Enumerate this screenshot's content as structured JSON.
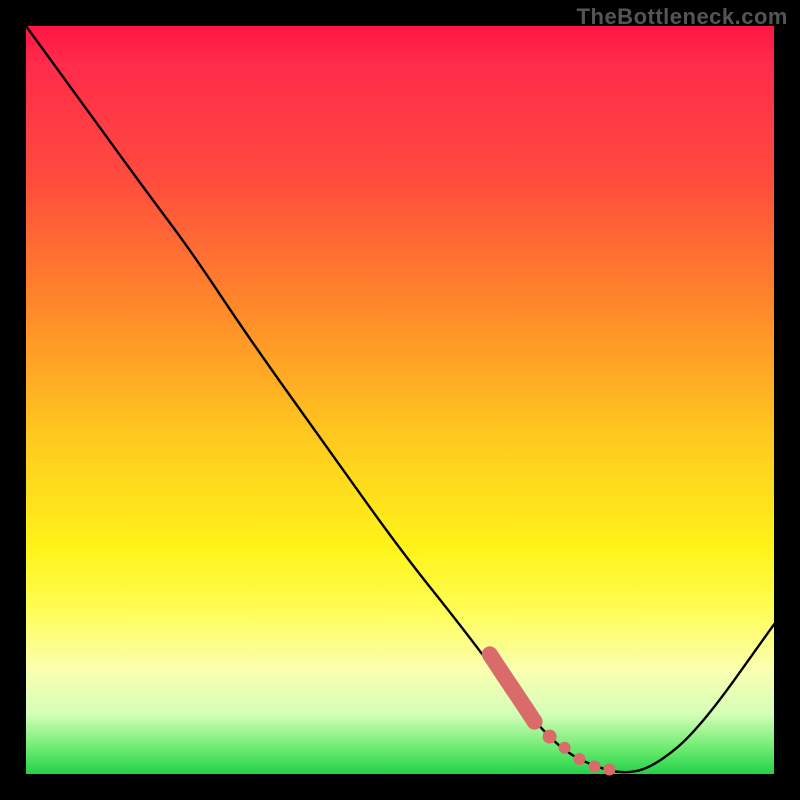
{
  "watermark": "TheBottleneck.com",
  "chart_data": {
    "type": "line",
    "title": "",
    "xlabel": "",
    "ylabel": "",
    "xlim": [
      0,
      100
    ],
    "ylim": [
      0,
      100
    ],
    "grid": false,
    "legend": false,
    "series": [
      {
        "name": "curve",
        "color": "#000000",
        "x": [
          0,
          8,
          16,
          22,
          30,
          40,
          50,
          58,
          64,
          68,
          72,
          76,
          80,
          84,
          90,
          100
        ],
        "y": [
          100,
          89,
          78,
          70,
          58,
          44,
          30,
          20,
          12,
          7,
          3,
          1,
          0,
          1,
          6,
          20
        ]
      }
    ],
    "highlight_segment": {
      "name": "highlight-dots",
      "color": "#d96b6b",
      "x": [
        62,
        63,
        64,
        65,
        66,
        67,
        68,
        70,
        72,
        74,
        76,
        78
      ],
      "y": [
        16,
        14.5,
        13,
        11.5,
        10,
        8.5,
        7,
        5,
        3.5,
        2,
        1,
        0.6
      ]
    }
  }
}
